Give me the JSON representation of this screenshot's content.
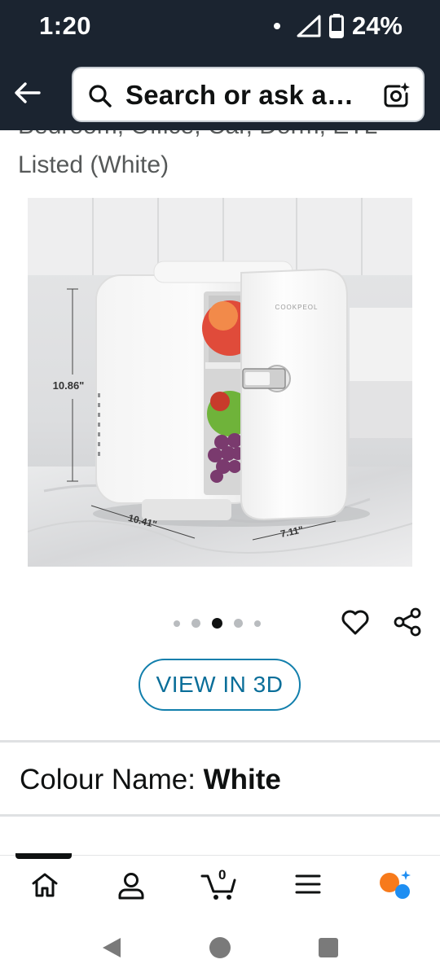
{
  "status_bar": {
    "time": "1:20",
    "battery": "24%",
    "icons": [
      "notification-dot",
      "signal-icon",
      "battery-icon"
    ]
  },
  "header": {
    "back_icon": "back-arrow-icon",
    "search_text": "Search or ask a…",
    "camera_icon": "camera-sparkle-icon"
  },
  "product": {
    "title_partial_line": "Bedroom, Office, Car, Dorm, ETL",
    "title_line": "Listed (White)",
    "image": {
      "brand_mark": "COOKPEOL",
      "dim_height": "10.86\"",
      "dim_depth": "10.41\"",
      "dim_width": "7.11\""
    },
    "carousel": {
      "total": 5,
      "active_index": 2
    },
    "view_3d_label": "VIEW IN 3D",
    "colour_label": "Colour Name: ",
    "colour_value": "White"
  },
  "bottom_nav": {
    "items": [
      "home-icon",
      "account-icon",
      "cart-icon",
      "menu-icon",
      "rufus-icon"
    ],
    "cart_count": "0",
    "active": "home-icon"
  },
  "system_nav": [
    "back-triangle-icon",
    "home-circle-icon",
    "recents-square-icon"
  ],
  "colors": {
    "header_bg": "#1b2430",
    "link_blue": "#0a6e99",
    "text_primary": "#0f1111",
    "text_secondary": "#565959",
    "accent_orange": "#f77a1b",
    "accent_blue": "#1e8ef2"
  }
}
